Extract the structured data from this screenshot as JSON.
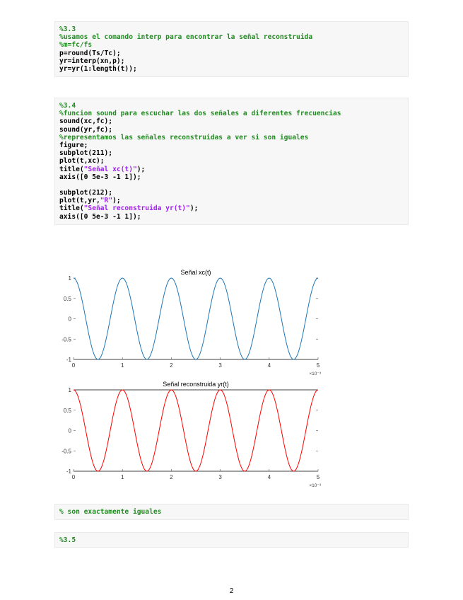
{
  "code_block_1": {
    "lines": [
      {
        "type": "comment",
        "text": "%3.3"
      },
      {
        "type": "comment",
        "text": "%usamos el comando interp para encontrar la señal reconstruida"
      },
      {
        "type": "comment",
        "text": "%m=fc/fs"
      },
      {
        "type": "code",
        "text": "p=round(Ts/Tc);"
      },
      {
        "type": "code",
        "text": "yr=interp(xn,p);"
      },
      {
        "type": "code",
        "text": "yr=yr(1:length(t));"
      }
    ]
  },
  "code_block_2": {
    "lines": [
      {
        "type": "comment",
        "text": "%3.4"
      },
      {
        "type": "comment",
        "text": "%funcion sound para escuchar las dos señales a diferentes frecuencias"
      },
      {
        "type": "code",
        "text": "sound(xc,fc);"
      },
      {
        "type": "code",
        "text": "sound(yr,fc);"
      },
      {
        "type": "comment",
        "text": "%representamos las señales reconstruidas a ver si son iguales"
      },
      {
        "type": "code",
        "text": "figure;"
      },
      {
        "type": "code",
        "text": "subplot(211);"
      },
      {
        "type": "code",
        "text": "plot(t,xc);"
      },
      {
        "type": "mixed",
        "pre": "title(",
        "str": "\"Señal xc(t)\"",
        "post": ");"
      },
      {
        "type": "code",
        "text": "axis([0 5e-3 -1 1]);"
      },
      {
        "type": "blank",
        "text": ""
      },
      {
        "type": "code",
        "text": "subplot(212);"
      },
      {
        "type": "mixed",
        "pre": "plot(t,yr,",
        "str": "\"R\"",
        "post": ");"
      },
      {
        "type": "mixed",
        "pre": "title(",
        "str": "\"Señal reconstruida yr(t)\"",
        "post": ");"
      },
      {
        "type": "code",
        "text": "axis([0 5e-3 -1 1]);"
      }
    ]
  },
  "code_block_3": {
    "lines": [
      {
        "type": "comment",
        "text": "% son exactamente iguales"
      }
    ]
  },
  "code_block_4": {
    "lines": [
      {
        "type": "comment",
        "text": "%3.5"
      }
    ]
  },
  "page_number": "2",
  "chart_data": [
    {
      "type": "line",
      "title": "Señal xc(t)",
      "color": "#1f77b4",
      "xlim": [
        0,
        5
      ],
      "ylim": [
        -1,
        1
      ],
      "x_ticks": [
        "0",
        "1",
        "2",
        "3",
        "4",
        "5"
      ],
      "y_ticks": [
        "1",
        "0.5",
        "0",
        "-0.5",
        "-1"
      ],
      "x_multiplier": "×10⁻³",
      "frequency_cycles_per_unit": 1,
      "series": [
        {
          "formula": "cos(2*pi*t)",
          "x_range": [
            0,
            5
          ]
        }
      ]
    },
    {
      "type": "line",
      "title": "Señal reconstruida yr(t)",
      "color": "#ff0000",
      "xlim": [
        0,
        5
      ],
      "ylim": [
        -1,
        1
      ],
      "x_ticks": [
        "0",
        "1",
        "2",
        "3",
        "4",
        "5"
      ],
      "y_ticks": [
        "1",
        "0.5",
        "0",
        "-0.5",
        "-1"
      ],
      "x_multiplier": "×10⁻³",
      "frequency_cycles_per_unit": 1,
      "series": [
        {
          "formula": "cos(2*pi*t)",
          "x_range": [
            0,
            5
          ]
        }
      ]
    }
  ]
}
